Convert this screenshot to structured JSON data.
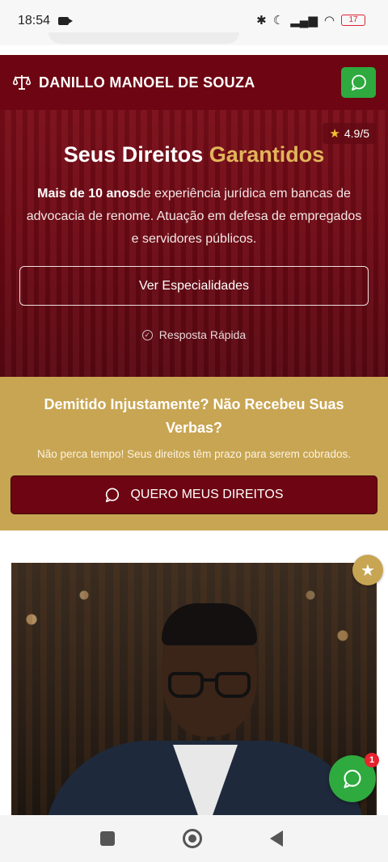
{
  "status_bar": {
    "time": "18:54",
    "battery": "17"
  },
  "header": {
    "brand": "DANILLO MANOEL DE SOUZA",
    "whatsapp_icon": "whatsapp-icon"
  },
  "hero": {
    "rating": "4.9/5",
    "title_main": "Seus Direitos ",
    "title_accent": "Garantidos",
    "desc_bold": "Mais de 10 anos",
    "desc_rest": "de experiência jurídica em bancas de advocacia de renome. Atuação em defesa de empregados e servidores públicos.",
    "button": "Ver Especialidades",
    "quick_reply": "Resposta Rápida"
  },
  "cta": {
    "title": "Demitido Injustamente? Não Recebeu Suas Verbas?",
    "subtitle": "Não perca tempo! Seus direitos têm prazo para serem cobrados.",
    "button": "QUERO MEUS DIREITOS"
  },
  "float": {
    "badge": "1"
  },
  "colors": {
    "primary": "#6e0512",
    "gold": "#c8a552",
    "accent_text": "#e2b55a",
    "whatsapp": "#2eaa3f"
  }
}
